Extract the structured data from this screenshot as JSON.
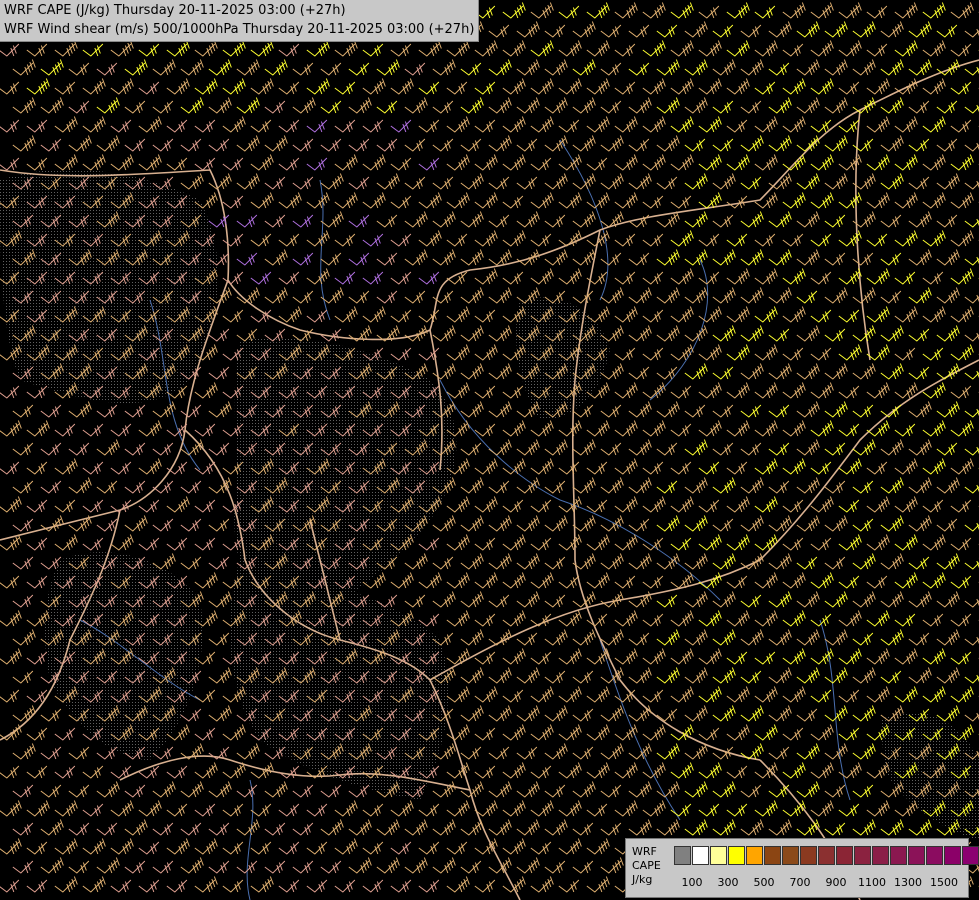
{
  "header": {
    "line1": "WRF CAPE (J/kg) Thursday 20-11-2025 03:00 (+27h)",
    "line2": "WRF Wind shear (m/s) 500/1000hPa Thursday 20-11-2025 03:00 (+27h)"
  },
  "legend": {
    "line1": "WRF",
    "line2": "CAPE",
    "line3": "J/kg",
    "swatch_colors": [
      "#808080",
      "#ffffff",
      "#ffff99",
      "#ffff00",
      "#ffa500",
      "#8b4513",
      "#8b4a1a",
      "#8b3a20",
      "#8b3030",
      "#8b2535",
      "#8b2240",
      "#8b1e48",
      "#8b1850",
      "#8b1258",
      "#8b0c60",
      "#8b0068",
      "#8b0070"
    ],
    "ticks": [
      "100",
      "300",
      "500",
      "700",
      "900",
      "1100",
      "1300",
      "1500"
    ]
  },
  "colors": {
    "background": "#000000",
    "border": "#d8b090",
    "river": "#4a6fb0",
    "barb_low": "#e0a090",
    "barb_mid": "#e0b070",
    "barb_high": "#ffff30",
    "barb_purple": "#b070e0",
    "barb_red": "#ff6060"
  },
  "map": {
    "layer_names": [
      "wind-barbs",
      "country-borders",
      "rivers",
      "terrain-contours"
    ]
  }
}
